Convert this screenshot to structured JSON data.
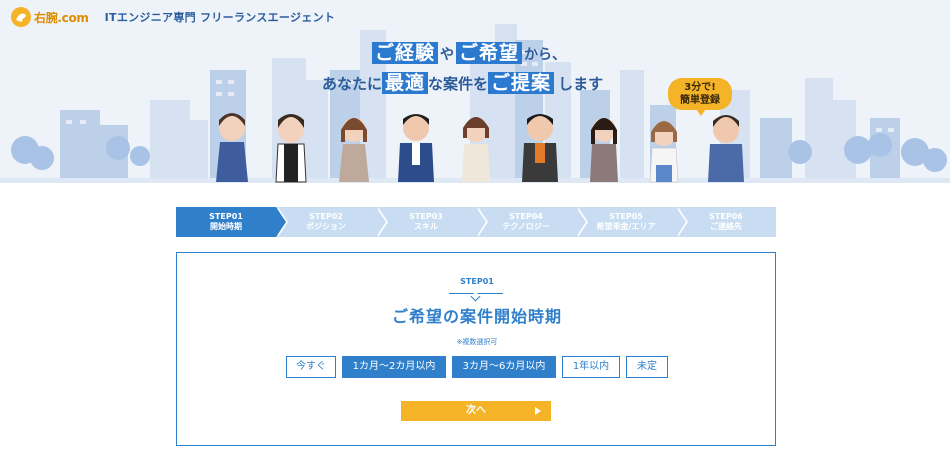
{
  "header": {
    "logo_text": "右腕.com",
    "tagline": "ITエンジニア専門 フリーランスエージェント"
  },
  "hero": {
    "line1": {
      "hl1": "ご経験",
      "s1": "や",
      "hl2": "ご希望",
      "s2": "から、"
    },
    "line2": {
      "p1": "あなたに",
      "hl1": "最適",
      "s1": "な案件を",
      "hl2": "ご提案",
      "s2": "します"
    },
    "badge_line1": "3分で!",
    "badge_line2": "簡単登録"
  },
  "steps": [
    {
      "num": "STEP01",
      "label": "開始時期",
      "active": true
    },
    {
      "num": "STEP02",
      "label": "ポジション",
      "active": false
    },
    {
      "num": "STEP03",
      "label": "スキル",
      "active": false
    },
    {
      "num": "STEP04",
      "label": "テクノロジー",
      "active": false
    },
    {
      "num": "STEP05",
      "label": "希望単金/エリア",
      "active": false
    },
    {
      "num": "STEP06",
      "label": "ご連絡先",
      "active": false
    }
  ],
  "question": {
    "step_label": "STEP01",
    "title": "ご希望の案件開始時期",
    "note": "※複数選択可",
    "options": [
      {
        "label": "今すぐ",
        "selected": false
      },
      {
        "label": "1カ月〜2カ月以内",
        "selected": true
      },
      {
        "label": "3カ月〜6カ月以内",
        "selected": true
      },
      {
        "label": "1年以内",
        "selected": false
      },
      {
        "label": "未定",
        "selected": false
      }
    ],
    "next_label": "次へ"
  },
  "colors": {
    "primary": "#2f7fcb",
    "step_inactive": "#c8ddf2",
    "accent": "#f5b328"
  }
}
